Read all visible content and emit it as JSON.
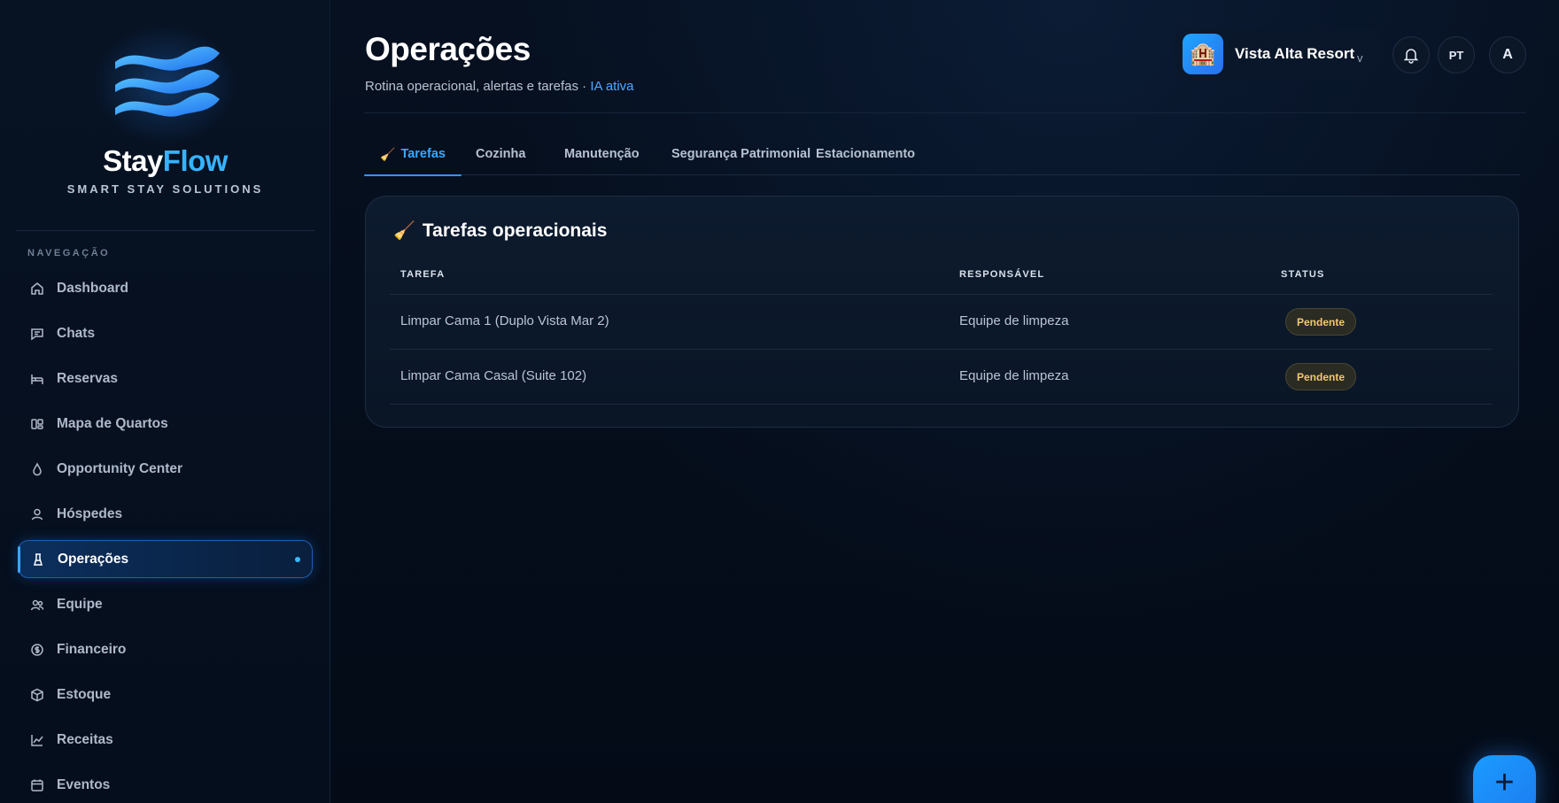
{
  "brand": {
    "name_part1": "Stay",
    "name_part2": "Flow",
    "tagline": "SMART STAY SOLUTIONS"
  },
  "sidebar": {
    "heading": "NAVEGAÇÃO",
    "items": [
      {
        "label": "Dashboard",
        "icon": "home-icon"
      },
      {
        "label": "Chats",
        "icon": "chat-icon"
      },
      {
        "label": "Reservas",
        "icon": "bed-icon"
      },
      {
        "label": "Mapa de Quartos",
        "icon": "layout-icon"
      },
      {
        "label": "Opportunity Center",
        "icon": "drop-icon"
      },
      {
        "label": "Hóspedes",
        "icon": "user-icon"
      },
      {
        "label": "Operações",
        "icon": "tool-icon",
        "active": true
      },
      {
        "label": "Equipe",
        "icon": "users-icon"
      },
      {
        "label": "Financeiro",
        "icon": "dollar-icon"
      },
      {
        "label": "Estoque",
        "icon": "box-icon"
      },
      {
        "label": "Receitas",
        "icon": "chart-icon"
      },
      {
        "label": "Eventos",
        "icon": "calendar-icon"
      }
    ]
  },
  "header": {
    "title": "Operações",
    "subtitle": "Rotina operacional, alertas e tarefas · ",
    "subtitle_highlight": "IA ativa",
    "hotel": {
      "name": "Vista Alta Resort",
      "icon": "hotel-icon",
      "caret": "v"
    },
    "language": "PT",
    "user_initial": "A"
  },
  "tabs": [
    {
      "label": "Tarefas",
      "active": true,
      "icon": "broom-icon"
    },
    {
      "label": "Cozinha"
    },
    {
      "label": "Manutenção"
    },
    {
      "label": "Segurança Patrimonial"
    },
    {
      "label": "Estacionamento"
    }
  ],
  "tasks_card": {
    "title": "Tarefas operacionais",
    "columns": [
      "TAREFA",
      "RESPONSÁVEL",
      "STATUS"
    ],
    "rows": [
      {
        "task": "Limpar Cama 1 (Duplo Vista Mar 2)",
        "owner": "Equipe de limpeza",
        "status": "Pendente"
      },
      {
        "task": "Limpar Cama Casal (Suite 102)",
        "owner": "Equipe de limpeza",
        "status": "Pendente"
      }
    ]
  },
  "fab": {
    "label": "+"
  },
  "colors": {
    "accent": "#35b3ff",
    "pending_text": "#f2c773",
    "active_nav": "#1f5fb4"
  }
}
